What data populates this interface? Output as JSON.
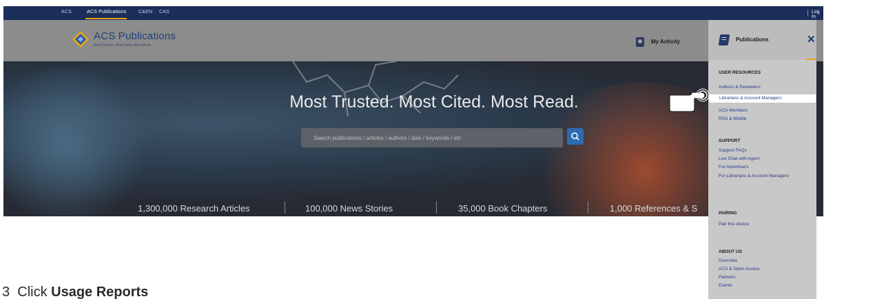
{
  "topbar": {
    "links": [
      "ACS",
      "ACS Publications",
      "C&EN",
      "CAS"
    ],
    "login": "Log In"
  },
  "header": {
    "logo_title": "ACS Publications",
    "logo_tagline": "Most Trusted. Most Cited. Most Read.",
    "my_activity": "My Activity"
  },
  "hero": {
    "tagline": "Most Trusted.  Most Cited.  Most Read.",
    "search_placeholder": "Search publications / articles / authors / dois / keywords / etc",
    "stats": [
      "1,300,000 Research Articles",
      "100,000 News Stories",
      "35,000 Book Chapters",
      "1,000 References & S"
    ]
  },
  "panel": {
    "title": "Publications",
    "close": "✕",
    "sections": [
      {
        "heading": "USER RESOURCES",
        "items": [
          "Authors & Reviewers",
          "Librarians & Account Managers",
          "ACS Members",
          "RSS & Mobile"
        ]
      },
      {
        "heading": "SUPPORT",
        "items": [
          "Support FAQs",
          "Live Chat with Agent",
          "For Advertisers",
          "For Librarians & Account Managers"
        ]
      },
      {
        "heading": "PAIRING",
        "items": [
          "Pair this device"
        ]
      },
      {
        "heading": "ABOUT US",
        "items": [
          "Overview",
          "ACS & Open Access",
          "Partners",
          "Events"
        ]
      }
    ]
  },
  "instruction": {
    "number": "3",
    "prefix": "Click ",
    "target": "Usage Reports"
  },
  "colors": {
    "topbar": "#1b2e5a",
    "accent": "#e8a317",
    "link": "#2a3a8a",
    "search_button": "#2c6bb0"
  }
}
